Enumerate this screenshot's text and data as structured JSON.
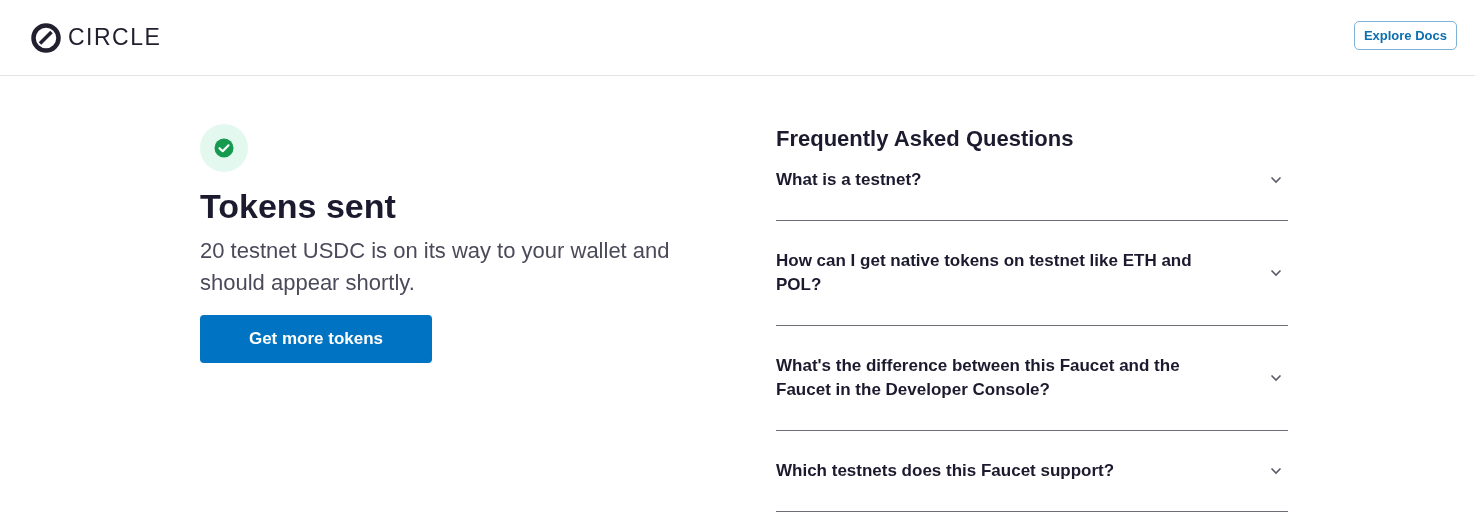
{
  "header": {
    "logo_text": "CIRCLE",
    "docs_button": "Explore Docs"
  },
  "status": {
    "title": "Tokens sent",
    "message": "20 testnet USDC is on its way to your wallet and should appear shortly.",
    "button": "Get more tokens"
  },
  "faq": {
    "title": "Frequently Asked Questions",
    "items": [
      {
        "question": "What is a testnet?",
        "expanded": false
      },
      {
        "question": "How can I get native tokens on testnet like ETH and POL?",
        "expanded": false
      },
      {
        "question": "What's the difference between this Faucet and the Faucet in the Developer Console?",
        "expanded": false
      },
      {
        "question": "Which testnets does this Faucet support?",
        "expanded": false
      }
    ]
  }
}
